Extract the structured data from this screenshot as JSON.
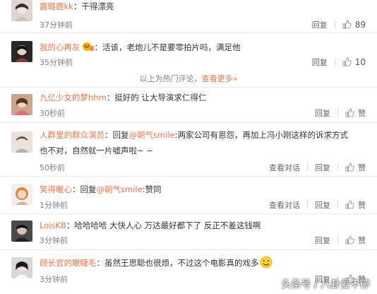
{
  "comments": [
    {
      "user": "露璐鹿kk",
      "sep": "：",
      "text": "干得漂亮",
      "time": "37分钟前",
      "reply": "回复",
      "likes": "89"
    },
    {
      "user": "我的心再灰",
      "sep": "：",
      "text": "活该，老炮儿不是要零拍片吗，满足他",
      "time": "35分钟前",
      "reply": "回复",
      "likes": "10"
    },
    {
      "user": "九亿少女的梦hhm",
      "sep": "：",
      "text": "挺好的  让大导演求仁得仁",
      "time": "30秒前",
      "reply": "回复",
      "likes": "赞"
    },
    {
      "user": "人群里的群众演员",
      "sep": "：",
      "reply_prefix": "回复",
      "mention": "@朝气smile",
      "text_line1": ":两家公司有恩怨，再加上冯小刚这样的诉求方式",
      "text_line2": "也不对，自然就一片嘘声啦~ ~",
      "time": "50秒前",
      "view": "查看对话",
      "reply": "回复",
      "likes": "赞"
    },
    {
      "user": "笑得暖心",
      "sep": "：",
      "reply_prefix": "回复",
      "mention": "@朝气smile",
      "text": ":赞同",
      "time": "1分钟前",
      "view": "查看对话",
      "reply": "回复",
      "likes": "赞"
    },
    {
      "user": "LoisKB",
      "sep": "：",
      "text": "哈哈哈哈  大快人心  万达最好都下了  反正不差这钱啊",
      "time": "3分钟前",
      "reply": "回复",
      "likes": "赞"
    },
    {
      "user": "顾长官的眼睫毛",
      "sep": "：",
      "text": "虽然王思聪也很烦，不过这个电影真的戏多",
      "time": "3分钟前",
      "reply": "回复",
      "likes": "赞"
    }
  ],
  "hot": {
    "prefix": "以上为热门评论，",
    "more": "查看更多",
    "suffix": "»"
  },
  "watermark": "头条号 / 八卦爱不停",
  "colors": {
    "username": "#eb7350",
    "time": "#808080",
    "separator": "#ececec"
  },
  "icons": {
    "like": "thumb-up-icon",
    "vip": "vip-badge-icon",
    "emoji": "grin-emoji-icon"
  }
}
